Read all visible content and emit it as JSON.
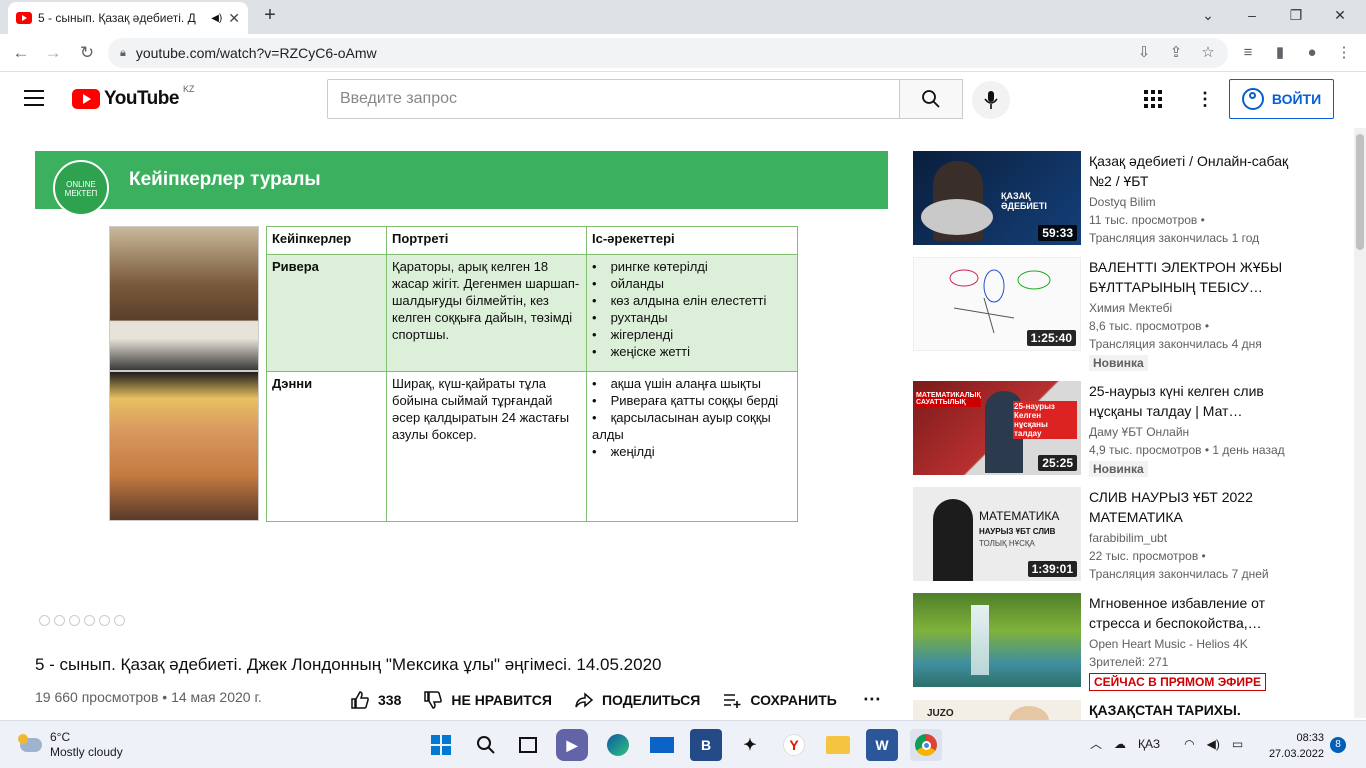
{
  "browser": {
    "tab_title": "5 - сынып. Қазақ әдебиеті. Д",
    "url": "youtube.com/watch?v=RZCyC6-oAmw"
  },
  "youtube": {
    "logo_text": "YouTube",
    "country_code": "KZ",
    "search_placeholder": "Введите запрос",
    "signin_label": "ВОЙТИ"
  },
  "slide": {
    "logo_text": "ONLINE МЕКТЕП",
    "title": "Кейіпкерлер туралы",
    "headers": [
      "Кейіпкерлер",
      "Портреті",
      "Іс-әрекеттері"
    ],
    "rows": [
      {
        "name": "Ривера",
        "portrait": "Қараторы, арық  келген 18 жасар жігіт. Дегенмен шаршап-шалдығуды білмейтін, кез келген соққыға дайын, төзімді спортшы.",
        "actions": [
          "рингке көтерілді",
          "ойланды",
          "көз алдына елін елестетті",
          "рухтанды",
          "жігерленді",
          "жеңіске жетті"
        ]
      },
      {
        "name": "Дэнни",
        "portrait": "Ширақ, күш-қайраты тұла бойына сыймай тұрғандай әсер қалдыратын 24 жастағы азулы боксер.",
        "actions": [
          "ақша үшін алаңға шықты",
          "Ривераға қатты соққы берді",
          "қарсыласынан ауыр соққы алды",
          "жеңілді"
        ]
      }
    ]
  },
  "video": {
    "title": "5 - сынып. Қазақ әдебиеті. Джек Лондонның \"Мексика ұлы\" әңгімесі. 14.05.2020",
    "views_date": "19 660 просмотров • 14 мая 2020 г.",
    "likes": "338",
    "dislike_label": "НЕ НРАВИТСЯ",
    "share_label": "ПОДЕЛИТЬСЯ",
    "save_label": "СОХРАНИТЬ"
  },
  "recommendations": [
    {
      "title": "Қазақ әдебиеті / Онлайн-сабақ №2 / ҰБТ",
      "channel": "Dostyq Bilim",
      "views": "11 тыс. просмотров •",
      "meta2": "Трансляция закончилась 1 год",
      "duration": "59:33",
      "badge": ""
    },
    {
      "title": "ВАЛЕНТТІ ЭЛЕКТРОН ЖҰБЫ БҰЛТТАРЫНЫҢ ТЕБІСУ…",
      "channel": "Химия Мектебі",
      "views": "8,6 тыс. просмотров •",
      "meta2": "Трансляция закончилась 4 дня",
      "duration": "1:25:40",
      "badge": "Новинка"
    },
    {
      "title": "25-наурыз күні келген слив нұсқаны талдау | Мат…",
      "channel": "Даму ҰБТ Онлайн",
      "views": "4,9 тыс. просмотров • 1 день назад",
      "meta2": "",
      "duration": "25:25",
      "badge": "Новинка"
    },
    {
      "title": "СЛИВ НАУРЫЗ ҰБТ 2022 МАТЕМАТИКА",
      "channel": "farabibilim_ubt",
      "views": "22 тыс. просмотров •",
      "meta2": "Трансляция закончилась 7 дней",
      "duration": "1:39:01",
      "badge": ""
    },
    {
      "title": "Мгновенное избавление от стресса и беспокойства,…",
      "channel": "Open Heart Music - Helios 4K",
      "views": "Зрителей: 271",
      "meta2": "",
      "duration": "",
      "badge": "",
      "live": "СЕЙЧАС В ПРЯМОМ ЭФИРЕ"
    },
    {
      "title": "ҚАЗАҚСТАН ТАРИХЫ.",
      "channel": "",
      "views": "",
      "meta2": "",
      "duration": "",
      "badge": ""
    }
  ],
  "thumb_texts": {
    "t1": "ҚАЗАҚ ӘДЕБИЕТІ",
    "t3a": "МАТЕМАТИКАЛЫҚ САУАТТЫЛЫҚ",
    "t3b": "25-наурыз Келген нұсқаны талдау",
    "t4a": "МАТЕМАТИКА",
    "t4b": "НАУРЫЗ ҰБТ СЛИВ",
    "t4c": "ТОЛЫҚ НҰСҚА",
    "t6": "JUZO"
  },
  "taskbar": {
    "temp": "6°C",
    "weather": "Mostly cloudy",
    "lang": "ҚАЗ",
    "time": "08:33",
    "date": "27.03.2022",
    "notifications": "8"
  }
}
